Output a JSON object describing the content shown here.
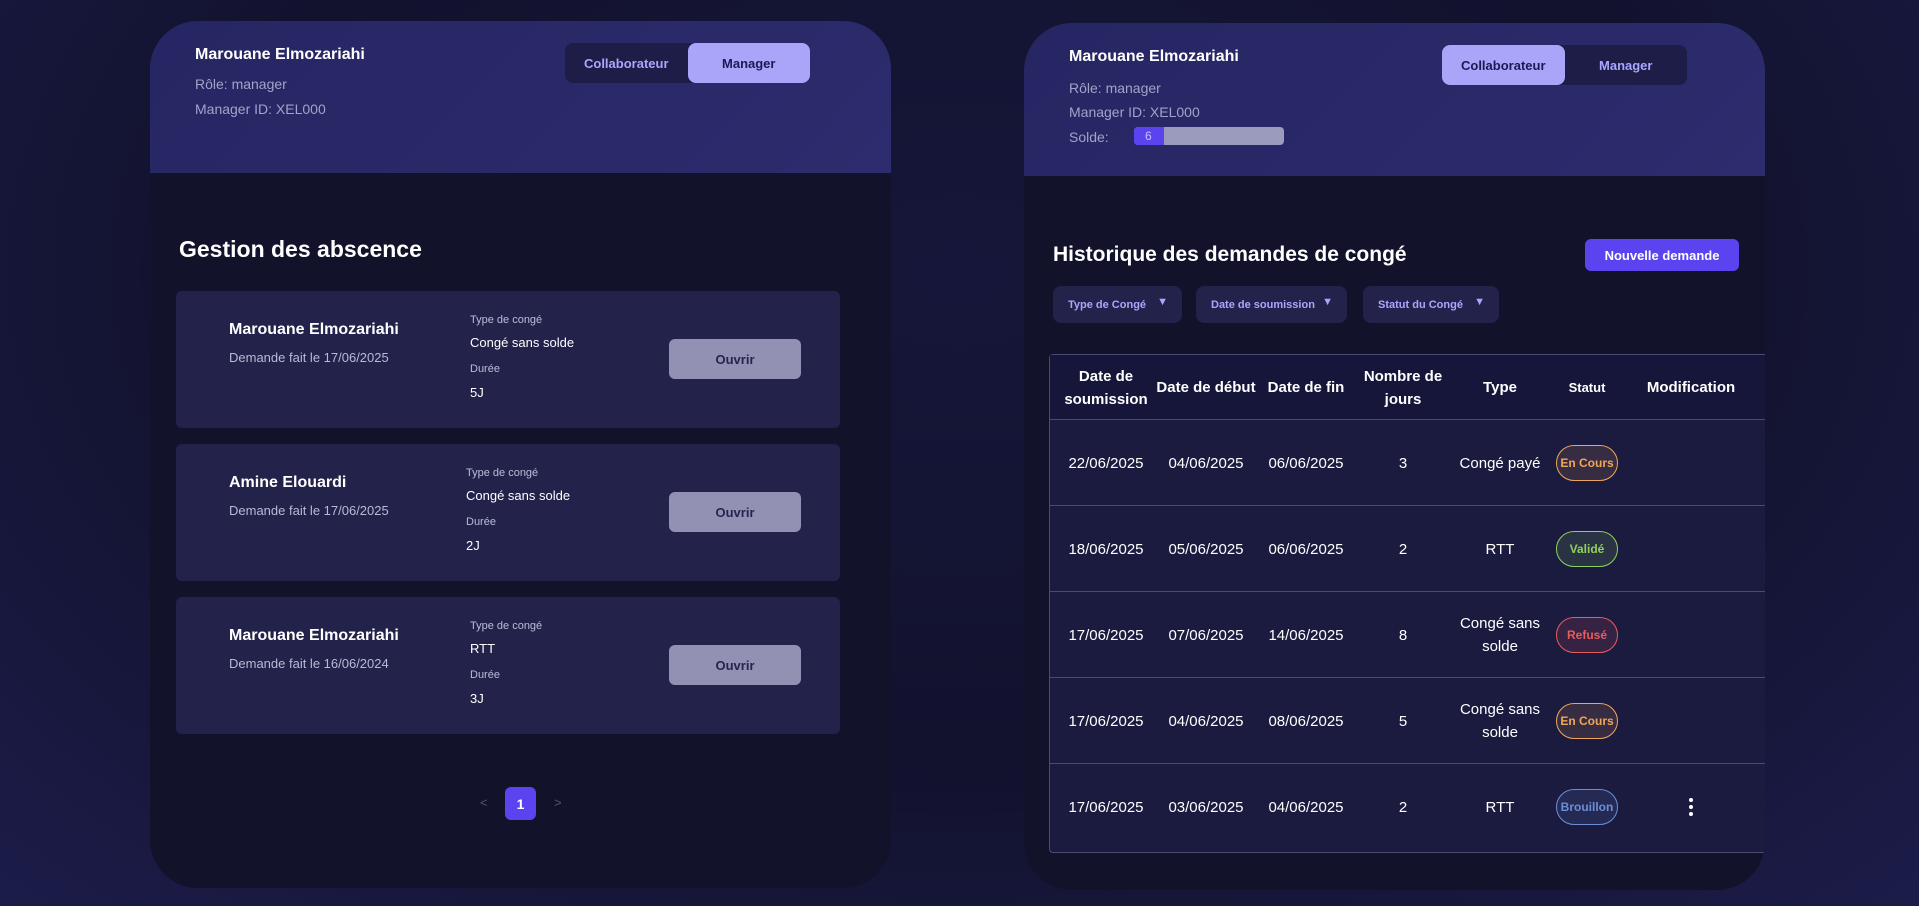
{
  "colors": {
    "accent": "#5b44f0",
    "toggle_active": "#a9a6fa",
    "status_en_cours": "#f0a65a",
    "status_valide": "#8fd15a",
    "status_refuse": "#e85c5c",
    "status_brouillon": "#6a8fd6"
  },
  "left": {
    "user": {
      "name": "Marouane Elmozariahi",
      "role": "Rôle: manager",
      "manager_id": "Manager ID: XEL000"
    },
    "toggle": {
      "option1": "Collaborateur",
      "option2": "Manager",
      "active": "Manager"
    },
    "title": "Gestion des abscence",
    "cards": [
      {
        "name": "Marouane Elmozariahi",
        "date": "Demande fait le 17/06/2025",
        "type_label": "Type de congé",
        "type": "Congé sans solde",
        "duration_label": "Durée",
        "duration": "5J",
        "button": "Ouvrir"
      },
      {
        "name": "Amine Elouardi",
        "date": "Demande fait le 17/06/2025",
        "type_label": "Type de congé",
        "type": "Congé sans solde",
        "duration_label": "Durée",
        "duration": "2J",
        "button": "Ouvrir"
      },
      {
        "name": "Marouane Elmozariahi",
        "date": "Demande fait le 16/06/2024",
        "type_label": "Type de congé",
        "type": "RTT",
        "duration_label": "Durée",
        "duration": "3J",
        "button": "Ouvrir"
      }
    ],
    "pagination": {
      "prev": "<",
      "current": "1",
      "next": ">"
    }
  },
  "right": {
    "user": {
      "name": "Marouane Elmozariahi",
      "role": "Rôle: manager",
      "manager_id": "Manager ID: XEL000",
      "solde_label": "Solde:",
      "solde_value": "6",
      "solde_fraction": 0.2
    },
    "toggle": {
      "option1": "Collaborateur",
      "option2": "Manager",
      "active": "Collaborateur"
    },
    "title": "Historique des demandes de congé",
    "new_request_button": "Nouvelle demande",
    "filters": [
      {
        "label": "Type de Congé",
        "icon": "caret-down-icon"
      },
      {
        "label": "Date de soumission",
        "icon": "caret-down-icon"
      },
      {
        "label": "Statut du Congé",
        "icon": "caret-down-icon"
      }
    ],
    "table": {
      "headers": [
        "Date de soumission",
        "Date de début",
        "Date de fin",
        "Nombre de jours",
        "Type",
        "Statut",
        "Modification"
      ],
      "rows": [
        {
          "submitted": "22/06/2025",
          "start": "04/06/2025",
          "end": "06/06/2025",
          "days": "3",
          "type": "Congé payé",
          "status": "En Cours",
          "status_key": "status_en_cours",
          "menu": false
        },
        {
          "submitted": "18/06/2025",
          "start": "05/06/2025",
          "end": "06/06/2025",
          "days": "2",
          "type": "RTT",
          "status": "Validé",
          "status_key": "status_valide",
          "menu": false
        },
        {
          "submitted": "17/06/2025",
          "start": "07/06/2025",
          "end": "14/06/2025",
          "days": "8",
          "type": "Congé sans solde",
          "status": "Refusé",
          "status_key": "status_refuse",
          "menu": false
        },
        {
          "submitted": "17/06/2025",
          "start": "04/06/2025",
          "end": "08/06/2025",
          "days": "5",
          "type": "Congé sans solde",
          "status": "En Cours",
          "status_key": "status_en_cours",
          "menu": false
        },
        {
          "submitted": "17/06/2025",
          "start": "03/06/2025",
          "end": "04/06/2025",
          "days": "2",
          "type": "RTT",
          "status": "Brouillon",
          "status_key": "status_brouillon",
          "menu": true
        }
      ]
    }
  }
}
